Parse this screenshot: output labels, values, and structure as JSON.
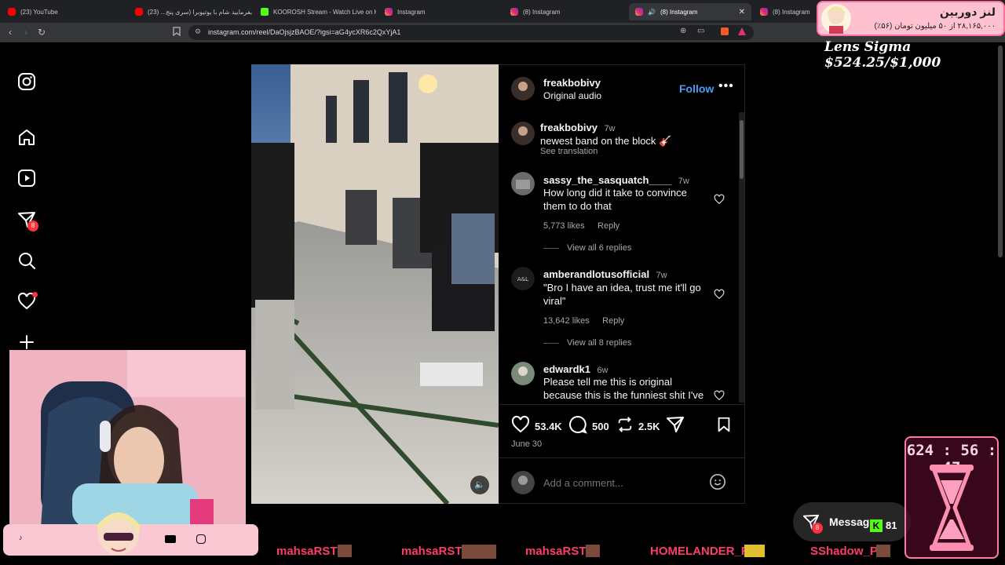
{
  "browser": {
    "tabs": [
      {
        "label": "(23) YouTube",
        "icon": "youtube"
      },
      {
        "label": "بفرمایید شام با یوتیوبرا (سری پنج... (23)",
        "icon": "youtube"
      },
      {
        "label": "KOOROSH Stream - Watch Live on K",
        "icon": "kick"
      },
      {
        "label": "Instagram",
        "icon": "instagram"
      },
      {
        "label": "(8) Instagram",
        "icon": "instagram"
      },
      {
        "label": "(8) Instagram",
        "icon": "instagram",
        "active": true
      },
      {
        "label": "(8) Instagram",
        "icon": "instagram"
      }
    ],
    "url": "instagram.com/reel/DaOjsjzBAOE/?igsi=aG4ycXR6c2QxYjA1"
  },
  "sidebar": {
    "messages_badge": "8"
  },
  "post": {
    "author": "freakbobivy",
    "audio": "Original audio",
    "follow_label": "Follow",
    "caption": {
      "user": "freakbobivy",
      "time": "7w",
      "text": "newest band on the block 🎸",
      "see_translation": "See translation"
    },
    "comments": [
      {
        "user": "sassy_the_sasquatch____",
        "time": "7w",
        "text": "How long did it take to convince them to do that",
        "likes": "5,773 likes",
        "reply": "Reply",
        "view_all": "View all 6 replies"
      },
      {
        "user": "amberandlotusofficial",
        "time": "7w",
        "text": "\"Bro I have an idea, trust me it'll go viral\"",
        "likes": "13,642 likes",
        "reply": "Reply",
        "view_all": "View all 8 replies"
      },
      {
        "user": "edwardk1",
        "time": "6w",
        "text": "Please tell me this is original because this is the funniest shit I've",
        "likes": "",
        "reply": "",
        "view_all": ""
      }
    ],
    "like_count": "53.4K",
    "comment_count": "500",
    "repost_count": "2.5K",
    "date": "June 30",
    "comment_placeholder": "Add a comment..."
  },
  "overlay": {
    "donation_title": "لنز دوربین",
    "donation_sub": "۲۸,۱۶۵,۰۰۰ از ۵۰ میلیون تومان (۵۶٪)",
    "lens_text": "Lens Sigma $524.25/$1,000",
    "timer": "624 : 56 : 47",
    "messages_label": "Messag",
    "messages_badge": "8",
    "kick_viewers": "81",
    "ticker": [
      "mahsaRST",
      "mahsaRST",
      "mahsaRST",
      "HOMELANDER_R",
      "SShadow_P"
    ]
  },
  "colors": {
    "accent_blue": "#4a9df8",
    "notification_red": "#ff3040",
    "panel_bg": "#000000"
  }
}
